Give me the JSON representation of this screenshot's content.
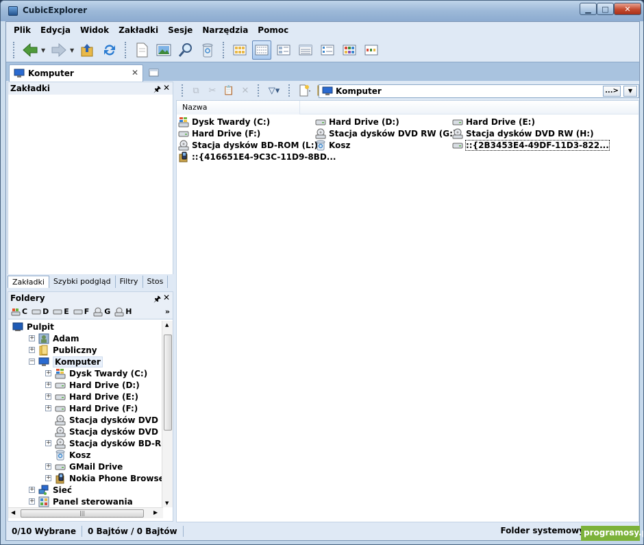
{
  "window": {
    "title": "CubicExplorer"
  },
  "menu": [
    "Plik",
    "Edycja",
    "Widok",
    "Zakładki",
    "Sesje",
    "Narzędzia",
    "Pomoc"
  ],
  "tab": {
    "label": "Komputer"
  },
  "bookmarks_pane": {
    "title": "Zakładki",
    "tabs": [
      "Zakładki",
      "Szybki podgląd",
      "Filtry",
      "Stos"
    ]
  },
  "folders_pane": {
    "title": "Foldery",
    "drives": [
      "C",
      "D",
      "E",
      "F",
      "G",
      "H"
    ],
    "tree": [
      {
        "label": "Pulpit",
        "icon": "desktop-icon",
        "level": 0,
        "expander": ""
      },
      {
        "label": "Adam",
        "icon": "user-folder-icon",
        "level": 1,
        "expander": "+"
      },
      {
        "label": "Publiczny",
        "icon": "folder-icon",
        "level": 1,
        "expander": "+"
      },
      {
        "label": "Komputer",
        "icon": "computer-icon",
        "level": 1,
        "expander": "−",
        "selected": true
      },
      {
        "label": "Dysk Twardy (C:)",
        "icon": "windows-drive-icon",
        "level": 2,
        "expander": "+"
      },
      {
        "label": "Hard Drive (D:)",
        "icon": "hard-drive-icon",
        "level": 2,
        "expander": "+"
      },
      {
        "label": "Hard Drive (E:)",
        "icon": "hard-drive-icon",
        "level": 2,
        "expander": "+"
      },
      {
        "label": "Hard Drive (F:)",
        "icon": "hard-drive-icon",
        "level": 2,
        "expander": "+"
      },
      {
        "label": "Stacja dysków DVD RW (G:",
        "icon": "optical-drive-icon",
        "level": 2,
        "expander": ""
      },
      {
        "label": "Stacja dysków DVD RW (H:",
        "icon": "optical-drive-icon",
        "level": 2,
        "expander": ""
      },
      {
        "label": "Stacja dysków BD-ROM (L:)",
        "icon": "optical-drive-icon",
        "level": 2,
        "expander": "+"
      },
      {
        "label": "Kosz",
        "icon": "recycle-bin-icon",
        "level": 2,
        "expander": ""
      },
      {
        "label": "GMail Drive",
        "icon": "hard-drive-icon",
        "level": 2,
        "expander": "+"
      },
      {
        "label": "Nokia Phone Browser",
        "icon": "phone-icon",
        "level": 2,
        "expander": "+"
      },
      {
        "label": "Sieć",
        "icon": "network-icon",
        "level": 1,
        "expander": "+"
      },
      {
        "label": "Panel sterowania",
        "icon": "control-panel-icon",
        "level": 1,
        "expander": "+"
      }
    ]
  },
  "address_bar": {
    "value": "Komputer",
    "go_label": "...>"
  },
  "file_list": {
    "column_header": "Nazwa",
    "items": [
      {
        "label": "Dysk Twardy (C:)",
        "icon": "windows-drive-icon"
      },
      {
        "label": "Hard Drive (D:)",
        "icon": "hard-drive-icon"
      },
      {
        "label": "Hard Drive (E:)",
        "icon": "hard-drive-icon"
      },
      {
        "label": "Hard Drive (F:)",
        "icon": "hard-drive-icon"
      },
      {
        "label": "Stacja dysków DVD RW (G:)",
        "icon": "optical-drive-icon"
      },
      {
        "label": "Stacja dysków DVD RW (H:)",
        "icon": "optical-drive-icon"
      },
      {
        "label": "Stacja dysków BD-ROM (L:)",
        "icon": "optical-drive-icon"
      },
      {
        "label": "Kosz",
        "icon": "recycle-bin-icon"
      },
      {
        "label": "::{2B3453E4-49DF-11D3-822...",
        "icon": "hard-drive-icon",
        "focused": true
      },
      {
        "label": "::{416651E4-9C3C-11D9-8BD...",
        "icon": "phone-icon"
      }
    ]
  },
  "status_bar": {
    "selection": "0/10 Wybrane",
    "size": "0 Bajtów / 0 Bajtów",
    "type": "Folder systemowy"
  },
  "watermark": "programosy.pl",
  "colors": {
    "accent": "#5f86b8",
    "selection": "#e8f0fb",
    "watermark": "#7cb23a"
  }
}
